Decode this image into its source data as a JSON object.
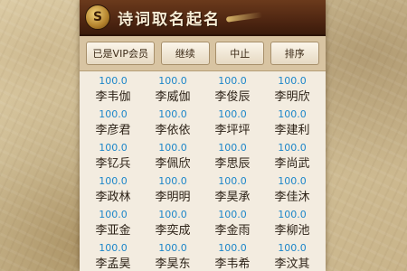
{
  "app": {
    "title": "诗词取名起名",
    "logo_glyph": "S",
    "logo_icon": "coin-logo-icon"
  },
  "toolbar": {
    "vip_label": "已是VIP会员",
    "continue_label": "继续",
    "stop_label": "中止",
    "sort_label": "排序"
  },
  "colors": {
    "titlebar": "#4a2310",
    "score_text": "#1c86c9",
    "name_text": "#2a1f14"
  },
  "names": [
    {
      "score": "100.0",
      "name": "李韦伽"
    },
    {
      "score": "100.0",
      "name": "李威伽"
    },
    {
      "score": "100.0",
      "name": "李俊辰"
    },
    {
      "score": "100.0",
      "name": "李明欣"
    },
    {
      "score": "100.0",
      "name": "李彦君"
    },
    {
      "score": "100.0",
      "name": "李依依"
    },
    {
      "score": "100.0",
      "name": "李坪坪"
    },
    {
      "score": "100.0",
      "name": "李建利"
    },
    {
      "score": "100.0",
      "name": "李钇兵"
    },
    {
      "score": "100.0",
      "name": "李佩欣"
    },
    {
      "score": "100.0",
      "name": "李思辰"
    },
    {
      "score": "100.0",
      "name": "李尚武"
    },
    {
      "score": "100.0",
      "name": "李政林"
    },
    {
      "score": "100.0",
      "name": "李明明"
    },
    {
      "score": "100.0",
      "name": "李昊承"
    },
    {
      "score": "100.0",
      "name": "李佳沐"
    },
    {
      "score": "100.0",
      "name": "李亚金"
    },
    {
      "score": "100.0",
      "name": "李奕成"
    },
    {
      "score": "100.0",
      "name": "李金雨"
    },
    {
      "score": "100.0",
      "name": "李柳池"
    },
    {
      "score": "100.0",
      "name": "李孟昊"
    },
    {
      "score": "100.0",
      "name": "李昊东"
    },
    {
      "score": "100.0",
      "name": "李韦希"
    },
    {
      "score": "100.0",
      "name": "李汶其"
    }
  ]
}
